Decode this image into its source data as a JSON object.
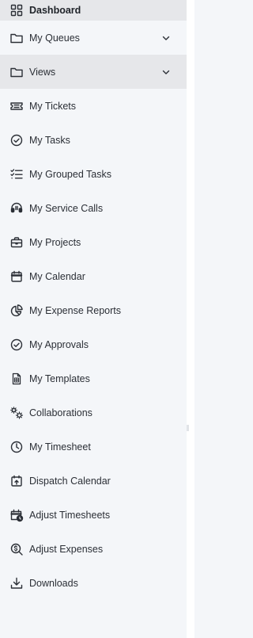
{
  "nav": {
    "items": [
      {
        "label": "Dashboard",
        "icon": "dashboard-grid-icon"
      },
      {
        "label": "My Queues",
        "icon": "folder-icon",
        "expandable": true
      },
      {
        "label": "Views",
        "icon": "folder-icon",
        "expandable": true,
        "selected": true
      },
      {
        "label": "My Tickets",
        "icon": "ticket-icon"
      },
      {
        "label": "My Tasks",
        "icon": "check-circle-icon"
      },
      {
        "label": "My Grouped Tasks",
        "icon": "checklist-icon"
      },
      {
        "label": "My Service Calls",
        "icon": "headset-icon"
      },
      {
        "label": "My Projects",
        "icon": "briefcase-icon"
      },
      {
        "label": "My Calendar",
        "icon": "calendar-icon"
      },
      {
        "label": "My Expense Reports",
        "icon": "pie-chart-icon"
      },
      {
        "label": "My Approvals",
        "icon": "check-circle-icon"
      },
      {
        "label": "My Templates",
        "icon": "document-icon"
      },
      {
        "label": "Collaborations",
        "icon": "gears-icon"
      },
      {
        "label": "My Timesheet",
        "icon": "clock-icon"
      },
      {
        "label": "Dispatch Calendar",
        "icon": "calendar-upload-icon"
      },
      {
        "label": "Adjust Timesheets",
        "icon": "calendar-clock-icon"
      },
      {
        "label": "Adjust Expenses",
        "icon": "search-dollar-icon"
      },
      {
        "label": "Downloads",
        "icon": "download-icon"
      }
    ]
  },
  "colors": {
    "background": "#f4f6f9",
    "selected_background": "#e6e7ea",
    "text": "#2b2f36",
    "icon": "#2b2f36"
  }
}
